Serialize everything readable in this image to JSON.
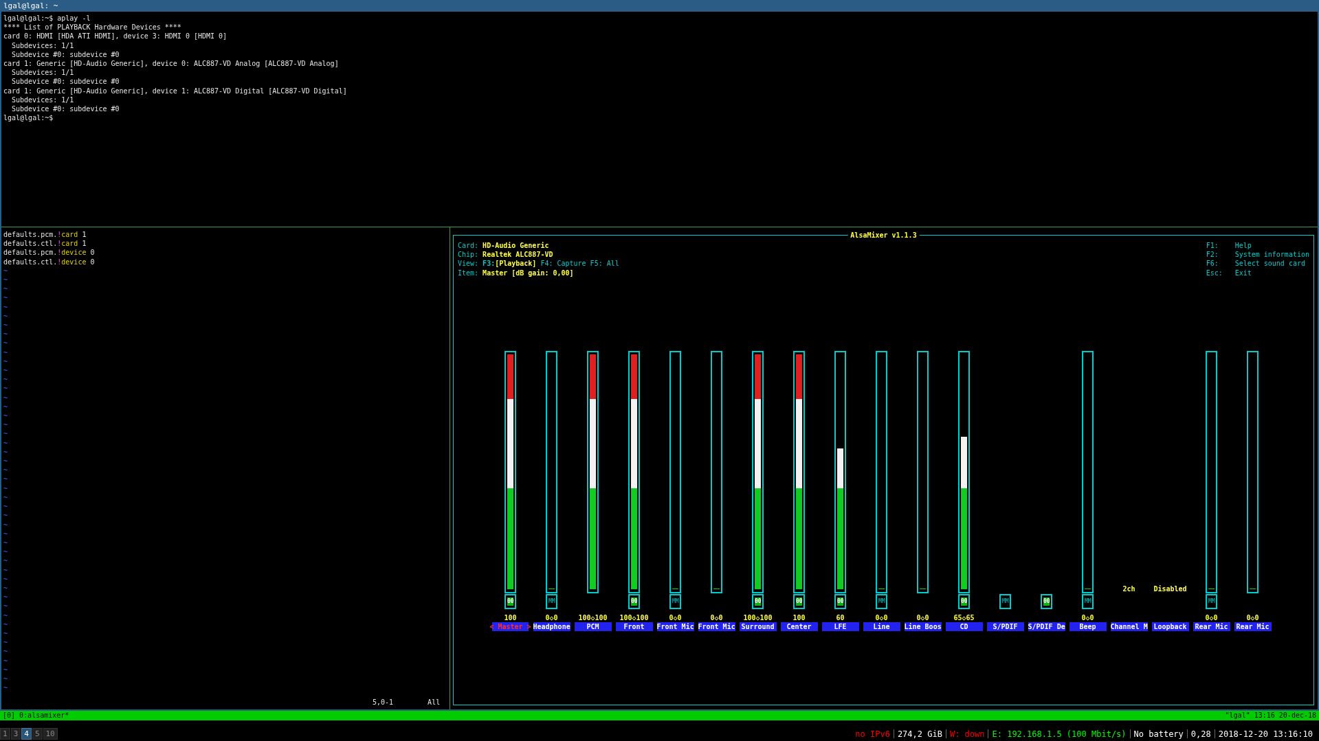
{
  "window": {
    "title": "lgal@lgal: ~"
  },
  "terminal_lines": [
    {
      "text": "lgal@lgal:~$ aplay -l",
      "indent": false
    },
    {
      "text": "**** List of PLAYBACK Hardware Devices ****",
      "indent": false
    },
    {
      "text": "card 0: HDMI [HDA ATI HDMI], device 3: HDMI 0 [HDMI 0]",
      "indent": false
    },
    {
      "text": "Subdevices: 1/1",
      "indent": true
    },
    {
      "text": "Subdevice #0: subdevice #0",
      "indent": true
    },
    {
      "text": "card 1: Generic [HD-Audio Generic], device 0: ALC887-VD Analog [ALC887-VD Analog]",
      "indent": false
    },
    {
      "text": "Subdevices: 1/1",
      "indent": true
    },
    {
      "text": "Subdevice #0: subdevice #0",
      "indent": true
    },
    {
      "text": "card 1: Generic [HD-Audio Generic], device 1: ALC887-VD Digital [ALC887-VD Digital]",
      "indent": false
    },
    {
      "text": "Subdevices: 1/1",
      "indent": true
    },
    {
      "text": "Subdevice #0: subdevice #0",
      "indent": true
    },
    {
      "text": "lgal@lgal:~$",
      "indent": false
    }
  ],
  "editor": {
    "lines": [
      {
        "segments": [
          {
            "text": "defaults.pcm.",
            "kind": "plain"
          },
          {
            "text": "!",
            "kind": "special"
          },
          {
            "text": "card",
            "kind": "keyword"
          },
          {
            "text": "1",
            "kind": "value"
          }
        ]
      },
      {
        "segments": [
          {
            "text": "defaults.ctl.",
            "kind": "plain"
          },
          {
            "text": "!",
            "kind": "special"
          },
          {
            "text": "card",
            "kind": "keyword"
          },
          {
            "text": "1",
            "kind": "value"
          }
        ]
      },
      {
        "segments": [
          {
            "text": "defaults.pcm.",
            "kind": "plain"
          },
          {
            "text": "!",
            "kind": "special"
          },
          {
            "text": "device",
            "kind": "keyword"
          },
          {
            "text": "0",
            "kind": "value"
          }
        ]
      },
      {
        "segments": [
          {
            "text": "defaults.ctl.",
            "kind": "plain"
          },
          {
            "text": "!",
            "kind": "special"
          },
          {
            "text": "device",
            "kind": "keyword"
          },
          {
            "text": "0",
            "kind": "value"
          }
        ]
      }
    ],
    "empty_markers": [
      "~",
      "~",
      "~",
      "~",
      "~",
      "~",
      "~",
      "~",
      "~",
      "~",
      "~",
      "~",
      "~",
      "~",
      "~",
      "~",
      "~",
      "~",
      "~",
      "~",
      "~",
      "~",
      "~",
      "~",
      "~",
      "~",
      "~",
      "~",
      "~",
      "~",
      "~",
      "~",
      "~",
      "~",
      "~",
      "~",
      "~",
      "~",
      "~",
      "~",
      "~",
      "~",
      "~",
      "~",
      "~",
      "~",
      "~"
    ],
    "cursor_position": "5,0-1",
    "scroll_position": "All"
  },
  "mixer": {
    "title": "AlsaMixer v1.1.3",
    "info": [
      {
        "label": "Card:",
        "value": "HD-Audio Generic"
      },
      {
        "label": "Chip:",
        "value": "Realtek ALC887-VD"
      }
    ],
    "view": {
      "label": "View:",
      "modes": [
        {
          "key": "F3:",
          "name": "[Playback]",
          "selected": true
        },
        {
          "key": "F4:",
          "name": "Capture",
          "selected": false
        },
        {
          "key": "F5:",
          "name": "All",
          "selected": false
        }
      ]
    },
    "item": {
      "label": "Item:",
      "value": "Master [dB gain: 0,00]"
    },
    "help": [
      {
        "key": "F1:",
        "action": "Help"
      },
      {
        "key": "F2:",
        "action": "System information"
      },
      {
        "key": "F6:",
        "action": "Select sound card"
      },
      {
        "key": "Esc:",
        "action": "Exit"
      }
    ],
    "selection_marks": [
      "<",
      ">"
    ],
    "channels": [
      {
        "name": "Master",
        "kind": "volume",
        "level": 1,
        "reading": "100",
        "switch": "00",
        "switch_on": true,
        "selected": true
      },
      {
        "name": "Headphone",
        "kind": "volume",
        "level": 0,
        "reading": "0◇0",
        "switch": "MM",
        "switch_on": false,
        "selected": false
      },
      {
        "name": "PCM",
        "kind": "volume",
        "level": 1,
        "reading": "100◇100",
        "selected": false
      },
      {
        "name": "Front",
        "kind": "volume",
        "level": 1,
        "reading": "100◇100",
        "switch": "00",
        "switch_on": true,
        "selected": false
      },
      {
        "name": "Front Mic",
        "kind": "volume",
        "level": 0,
        "reading": "0◇0",
        "switch": "MM",
        "switch_on": false,
        "selected": false
      },
      {
        "name": "Front Mic",
        "kind": "volume",
        "level": 0,
        "reading": "0◇0",
        "selected": false
      },
      {
        "name": "Surround",
        "kind": "volume",
        "level": 1,
        "reading": "100◇100",
        "switch": "00",
        "switch_on": true,
        "selected": false
      },
      {
        "name": "Center",
        "kind": "volume",
        "level": 1,
        "reading": "100",
        "switch": "00",
        "switch_on": true,
        "selected": false
      },
      {
        "name": "LFE",
        "kind": "volume",
        "level": 0.6,
        "reading": "60",
        "switch": "00",
        "switch_on": true,
        "selected": false
      },
      {
        "name": "Line",
        "kind": "volume",
        "level": 0,
        "reading": "0◇0",
        "switch": "MM",
        "switch_on": false,
        "selected": false
      },
      {
        "name": "Line Boos",
        "kind": "volume",
        "level": 0,
        "reading": "0◇0",
        "selected": false
      },
      {
        "name": "CD",
        "kind": "volume",
        "level": 0.65,
        "reading": "65◇65",
        "switch": "00",
        "switch_on": true,
        "selected": false
      },
      {
        "name": "S/PDIF",
        "kind": "switch",
        "switch": "MM",
        "switch_on": false,
        "selected": false
      },
      {
        "name": "S/PDIF De",
        "kind": "switch",
        "switch": "00",
        "switch_on": true,
        "selected": false
      },
      {
        "name": "Beep",
        "kind": "volume",
        "level": 0,
        "reading": "0◇0",
        "switch": "MM",
        "switch_on": false,
        "selected": false
      },
      {
        "name": "Channel M",
        "kind": "enum",
        "value": "2ch",
        "selected": false
      },
      {
        "name": "Loopback",
        "kind": "enum",
        "value": "Disabled",
        "selected": false
      },
      {
        "name": "Rear Mic",
        "kind": "volume",
        "level": 0,
        "reading": "0◇0",
        "switch": "MM",
        "switch_on": false,
        "selected": false
      },
      {
        "name": "Rear Mic",
        "kind": "volume",
        "level": 0,
        "reading": "0◇0",
        "selected": false
      }
    ]
  },
  "tmux_bar": {
    "window": "[0] 0:alsamixer*",
    "right": "\"lgal\" 13:16 20-dec-18"
  },
  "workspaces": [
    {
      "label": "1",
      "selected": false
    },
    {
      "label": "3",
      "selected": false
    },
    {
      "label": "4",
      "selected": true
    },
    {
      "label": "5",
      "selected": false
    },
    {
      "label": "10",
      "selected": false
    }
  ],
  "status": [
    {
      "text": "no IPv6",
      "color": "#ff0000"
    },
    {
      "text": "274,2 GiB",
      "color": "#ffffff"
    },
    {
      "text": "W: down",
      "color": "#ff0000"
    },
    {
      "text": "E: 192.168.1.5 (100 Mbit/s)",
      "color": "#00ff00"
    },
    {
      "text": "No battery",
      "color": "#ffffff"
    },
    {
      "text": "0,28",
      "color": "#ffffff"
    },
    {
      "text": "2018-12-20 13:16:10",
      "color": "#ffffff"
    }
  ]
}
